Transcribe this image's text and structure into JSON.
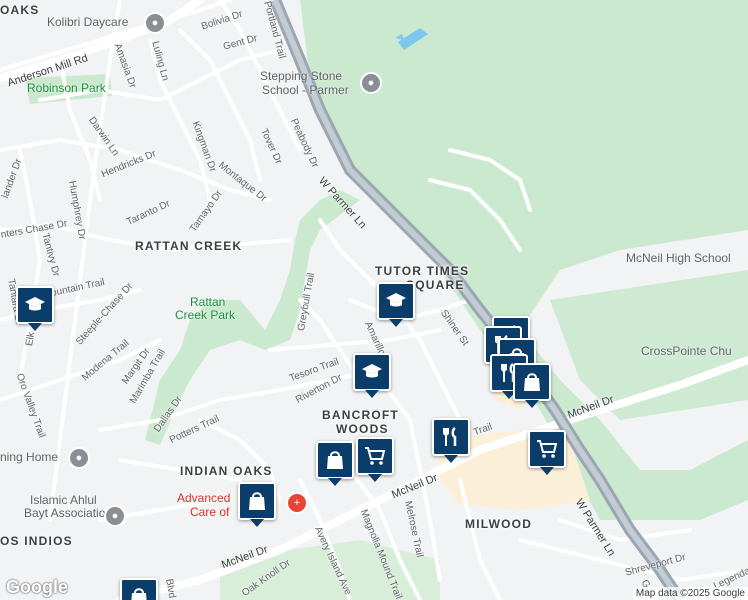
{
  "map": {
    "colors": {
      "background": "#f1f3f4",
      "park": "#cbe9cf",
      "road": "#ffffff",
      "highway": "#9aa6b2",
      "commercial": "#fbf0d7",
      "water": "#7ec6ee",
      "pin": "#0b3d6b"
    },
    "labels": {
      "areas": {
        "oaks": "OAKS",
        "rattan_creek": "RATTAN CREEK",
        "tutor_times_1": "TUTOR TIMES",
        "tutor_times_2": "SQUARE",
        "bancroft_1": "BANCROFT",
        "bancroft_2": "WOODS",
        "indian_oaks": "INDIAN OAKS",
        "milwood": "MILWOOD",
        "los_indios": "OS INDIOS"
      },
      "parks": {
        "robinson": "Robinson Park",
        "rattan_1": "Rattan",
        "rattan_2": "Creek Park"
      },
      "poi": {
        "kolibri": "Kolibri Daycare",
        "stepping_1": "Stepping Stone",
        "stepping_2": "School - Parmer",
        "mcneil_hs": "McNeil High School",
        "crosspointe": "CrossPointe Chu",
        "funeral": "ning Home",
        "islamic_1": "Islamic Ahlul",
        "islamic_2": "Bayt Association",
        "advanced_1": "Advanced",
        "advanced_2": "Care of"
      },
      "major_roads": {
        "parmer_n": "W Parmer Ln",
        "parmer_s": "W Parmer Ln",
        "mcneil_e": "McNeil Dr",
        "mcneil_c": "McNeil Dr",
        "mcneil_w": "McNeil Dr",
        "anderson": "Anderson Mill Rd"
      },
      "streets": {
        "bolivia": "Bolivia Dr",
        "gent": "Gent Dr",
        "portland": "Portland Trail",
        "amasia": "Amasia Dr",
        "luling": "Luling Ln",
        "darwin": "Darwin Ln",
        "hendricks": "Hendricks Dr",
        "kingman": "Kingman Dr",
        "tover": "Tover Dr",
        "peabody": "Peabody Dr",
        "montaque": "Montaque Dr",
        "humphrey": "Humphrey Dr",
        "taranto": "Taranto Dr",
        "tamayo": "Tamayo Dr",
        "hunters": "nters Chase Dr",
        "tantivy": "Tantivy Dr",
        "lander": "lander Dr",
        "mountain": "Mountain Trail",
        "tantara": "Tantara Dr",
        "elk": "Elk",
        "steeple": "Steeple-Chase Dr",
        "modena": "Modena Trail",
        "margit": "Margit Dr",
        "marimba": "Marimba Trail",
        "oro": "Oro Valley Trail",
        "dallas": "Dallas Dr",
        "potters": "Potters Trail",
        "greybull": "Greybull Trail",
        "tesoro": "Tesoro Trail",
        "riverton": "Riverton Dr",
        "amarillo": "Amarillo",
        "shiner": "Shiner St",
        "melrose": "Melrose Trail",
        "magnolia": "Magnolia Mound Trail",
        "avery": "Avery Island Ave",
        "oak_knoll": "Oak Knoll Dr",
        "shreveport": "Shreveport Dr",
        "legend": "Legenda",
        "blvd": "Blvd",
        "trail_c": "Trail",
        "g_dr": "G"
      }
    },
    "pins": [
      {
        "icon": "graduation-cap"
      },
      {
        "icon": "graduation-cap"
      },
      {
        "icon": "graduation-cap"
      },
      {
        "icon": "fork-knife"
      },
      {
        "icon": "fork-knife"
      },
      {
        "icon": "fork-knife"
      },
      {
        "icon": "shopping-bag"
      },
      {
        "icon": "shopping-bag"
      },
      {
        "icon": "shopping-bag"
      },
      {
        "icon": "shopping-bag"
      },
      {
        "icon": "shopping-cart"
      },
      {
        "icon": "shopping-cart"
      }
    ],
    "attribution": "Map data ©2025 Google",
    "logo": "Google"
  }
}
